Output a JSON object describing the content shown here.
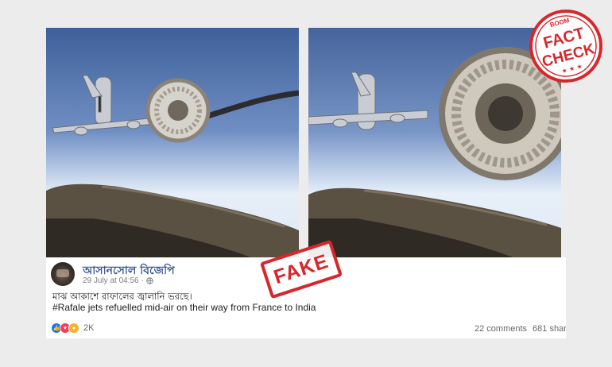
{
  "badge": {
    "brand": "BOOM",
    "line1": "FACT",
    "line2": "CHECK",
    "color": "#d8262b"
  },
  "stamp": {
    "label": "FAKE",
    "color": "#d8262b"
  },
  "post": {
    "page_name": "আসানসোল বিজেপি",
    "date": "29 July at 04:56",
    "separator": "·",
    "privacy_icon": "globe-icon",
    "text_line1": "মাঝ আকাশে রাফালের জ্বালানি ভরছে।",
    "text_line2": "#Rafale jets refuelled mid-air on their way from France to India",
    "reactions_count": "2K",
    "reaction_icons": [
      "like-icon",
      "love-icon",
      "wow-icon"
    ],
    "comments": "22 comments",
    "shares": "681 shar"
  },
  "colors": {
    "link": "#385898",
    "like": "#1877f2",
    "love": "#f33e58",
    "wow": "#f7b125"
  }
}
